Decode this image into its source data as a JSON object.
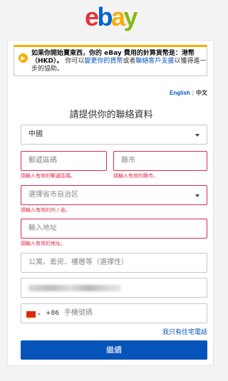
{
  "logo": {
    "letters": [
      "e",
      "b",
      "a",
      "y"
    ],
    "colors": [
      "#e53238",
      "#0064d2",
      "#f5af02",
      "#86b817"
    ]
  },
  "alert": {
    "bold_text": "如果你開始賣東西，你的 eBay 費用的計算貨幣是：港幣（HKD）。",
    "text_1": "你可以",
    "link_1": "變更你的貨幣",
    "text_2": "或者",
    "link_2": "聯絡客戶支援",
    "text_3": "以獲得進一步的協助。",
    "icon": "arrow-right-icon"
  },
  "language": {
    "english": "English",
    "separator": "|",
    "chinese": "中文"
  },
  "form": {
    "title": "請提供你的聯絡資料",
    "country": "中國",
    "postal_code_placeholder": "郵遞區碼",
    "postal_code_error": "請輸入有效的郵遞區碼。",
    "city_placeholder": "縣市",
    "city_error": "請輸入有效的縣市。",
    "province_placeholder": "選擇省市自治区",
    "province_error": "請輸入有效的州 / 省。",
    "address_placeholder": "輸入地址",
    "address_error": "請輸入有效的地址。",
    "address2_placeholder": "公寓、套房、樓層等（選擇性）",
    "phone_country_code": "+86",
    "phone_placeholder": "手機號碼",
    "landline_link": "我只有住宅電話",
    "continue_button": "繼續"
  },
  "colors": {
    "accent": "#0654ba",
    "error": "#e0284a",
    "alert_border": "#f5af02"
  }
}
